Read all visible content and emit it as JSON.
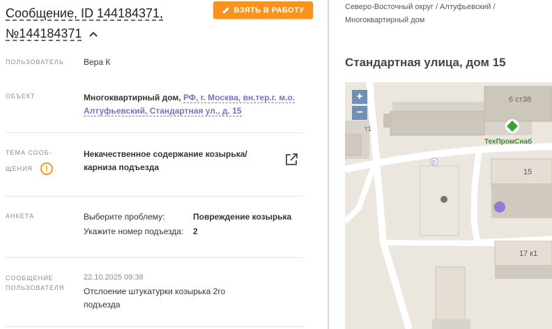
{
  "header": {
    "title": "Сообщение, ID 144184371, №144184371",
    "take_button_label": "ВЗЯТЬ В РАБОТУ"
  },
  "fields": {
    "user_label": "ПОЛЬЗОВАТЕЛЬ",
    "user_value": "Вера К",
    "object_label": "ОБЪЕКТ",
    "object_type": "Многоквартирный дом,",
    "object_address": "РФ, г. Москва, вн.тер.г. м.о. Алтуфьевский, Стандартная ул., д. 15",
    "topic_label_1": "ТЕМА СООБ-",
    "topic_label_2": "ЩЕНИЯ",
    "topic_value": "Некачественное содержание козырька/ карниза подъезда",
    "survey_label": "АНКЕТА",
    "survey": [
      {
        "question": "Выберите проблему:",
        "answer": "Повреждение козырька"
      },
      {
        "question": "Укажите номер подъезда:",
        "answer": "2"
      }
    ],
    "message_label_1": "СООБЩЕНИЕ",
    "message_label_2": "ПОЛЬЗОВАТЕЛЯ",
    "message_date": "22.10.2025 09:38",
    "message_text": "Отслоение штукатурки козырька 2го подъезда"
  },
  "map_panel": {
    "breadcrumb": "Северо-Восточный округ / Алтуфьевский / Многоквартирный дом",
    "address": "Стандартная улица, дом 15",
    "zoom_in": "+",
    "zoom_out": "−",
    "labels": {
      "building_top": "6 ст38",
      "poi": "ТехПромСнаб",
      "building_15": "15",
      "building_17": "17 к1",
      "left_edge": "т1",
      "parking": "P"
    }
  },
  "colors": {
    "accent": "#f7931e",
    "link": "#7a6fc2",
    "marker": "#8e7ad6",
    "poi": "#3aa033"
  }
}
